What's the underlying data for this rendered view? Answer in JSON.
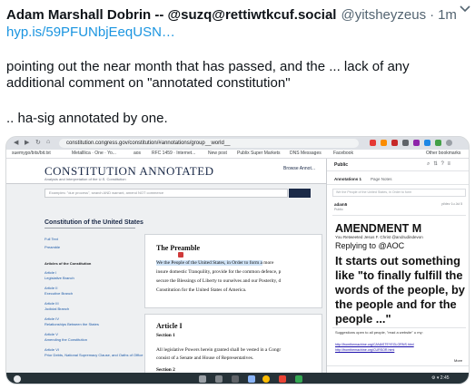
{
  "tweet": {
    "display_name": "Adam Marshall Dobrin -- @suzq@rettiwtkcuf.social",
    "handle": "@yitsheyzeus",
    "separator": "·",
    "time": "1m",
    "link": "hyp.is/59PFUNbjEeqUSN…",
    "body_line1": "pointing out the near month that has passed, and the ... lack of any",
    "body_line2": "additional comment on \"annotated constitution\"",
    "body_line3": ".. ha-sig annotated by one."
  },
  "screenshot": {
    "browser": {
      "url": "constitution.congress.gov/constitution/#annotations/group__world__",
      "bookmarks": [
        "suemygo/bits/bit.txt",
        "Metalllica · One · Yo...",
        "aos",
        "RFC 1459 · Internet...",
        "New post",
        "Publix Super Markets",
        "DNS Messages",
        "Facebook"
      ],
      "other_bookmarks": "Other bookmarks"
    },
    "site": {
      "logo": "CONSTITUTION ANNOTATED",
      "logo_sub": "Analysis and Interpretation of the U.S. Constitution",
      "browse": "Browse Annot...",
      "search_placeholder": "Examples: \"due process\", search AND warrant, amend NOT commerce",
      "toc_title": "Constitution of the United States",
      "toc_items": [
        "Full Text",
        "Preamble"
      ],
      "toc_heading": "Articles of the Constitution",
      "toc_articles": [
        {
          "title": "Article I",
          "sub": "Legislative Branch"
        },
        {
          "title": "Article II",
          "sub": "Executive Branch"
        },
        {
          "title": "Article III",
          "sub": "Judicial Branch"
        },
        {
          "title": "Article IV",
          "sub": "Relationships Between the States"
        },
        {
          "title": "Article V",
          "sub": "Amending the Constitution"
        },
        {
          "title": "Article VI",
          "sub": "Prior Debts, National Supremacy Clause, and Oaths of Office"
        }
      ],
      "preamble": {
        "title": "The Preamble",
        "highlighted": "We the People of the United States, in Order to form a",
        "line1_rest": " more",
        "line2": "insure domestic Tranquility, provide for the common defence, p",
        "line3": "secure the Blessings of Liberty to ourselves and our Posterity, d",
        "line4": "Constitution for the United States of America."
      },
      "article": {
        "title": "Article I",
        "section1": "Section 1",
        "text1": "All legislative Powers herein granted shall be vested in a Congr",
        "text2": "consist of a Senate and House of Representatives.",
        "section2": "Section 2"
      }
    },
    "hypothesis": {
      "public_label": "Public",
      "tabs": [
        "Annotations 1",
        "Page Notes"
      ],
      "input_placeholder": "We the People of the United States, in Order to form",
      "user": "adam5",
      "user_time": "yt/dev 1u Jul 5",
      "group": "Public",
      "amendment": "AMENDMENT M",
      "retweet_line": "You Retweeted Jesus F. Christ @andrudindevon",
      "reply": "Replying to @AOC",
      "quote_lines": [
        "It starts out something",
        "like \"to finally fulfill the",
        "words of the people, by",
        "the people and for the",
        "people ...\""
      ],
      "suggestion": "Suggestions open to all people, \"read a website\" u my:",
      "links": [
        "http://fromthemachine.org/CANASTEYEGLORNS.html",
        "http://fromthemachine.org/CURSOR.html"
      ],
      "more": "More"
    },
    "shelf": {
      "status": "⚙ ▾ 2:45"
    }
  }
}
